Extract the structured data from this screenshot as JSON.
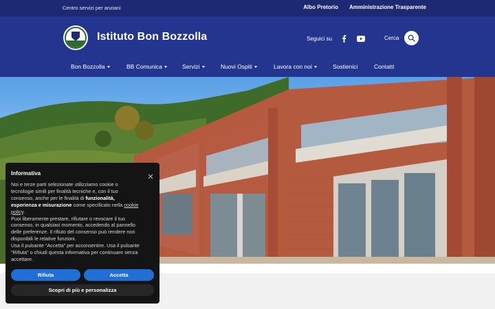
{
  "topbar": {
    "tagline": "Centro servizi per anziani",
    "links": [
      "Albo Pretorio",
      "Amministrazione Trasparente"
    ]
  },
  "header": {
    "title": "Istituto Bon Bozzolla",
    "social_label": "Seguici su",
    "search_label": "Cerca"
  },
  "nav": {
    "items": [
      {
        "label": "Bon Bozzolla",
        "has_dropdown": true
      },
      {
        "label": "BB Comunica",
        "has_dropdown": true
      },
      {
        "label": "Servizi",
        "has_dropdown": true
      },
      {
        "label": "Nuovi Ospiti",
        "has_dropdown": true
      },
      {
        "label": "Lavora con noi",
        "has_dropdown": true
      },
      {
        "label": "Sostienici",
        "has_dropdown": false
      },
      {
        "label": "Contatti",
        "has_dropdown": false
      }
    ]
  },
  "cookie": {
    "title": "Informativa",
    "p1_a": "Noi e terze parti selezionate utilizziamo cookie o tecnologie simili per finalità tecniche e, con il tuo consenso, anche per le finalità di ",
    "p1_b": "funzionalità, esperienza e misurazione",
    "p1_c": " come specificato nella ",
    "p1_link": "cookie policy",
    "p1_d": ".",
    "p2": "Puoi liberamente prestare, rifiutare o revocare il tuo consenso, in qualsiasi momento, accedendo al pannello delle preferenze. Il rifiuto del consenso può rendere non disponibili le relative funzioni.",
    "p3": "Usa il pulsante “Accetta” per acconsentire. Usa il pulsante “Rifiuta” o chiudi questa informativa per continuare senza accettare.",
    "reject_label": "Rifiuta",
    "accept_label": "Accetta",
    "more_label": "Scopri di più e personalizza"
  },
  "colors": {
    "topbar": "#1d2a73",
    "header": "#23358f",
    "accent_button": "#1f6fd6"
  },
  "icons": [
    "logo",
    "facebook-icon",
    "youtube-icon",
    "search-icon",
    "close-icon",
    "chevron-down-icon"
  ]
}
